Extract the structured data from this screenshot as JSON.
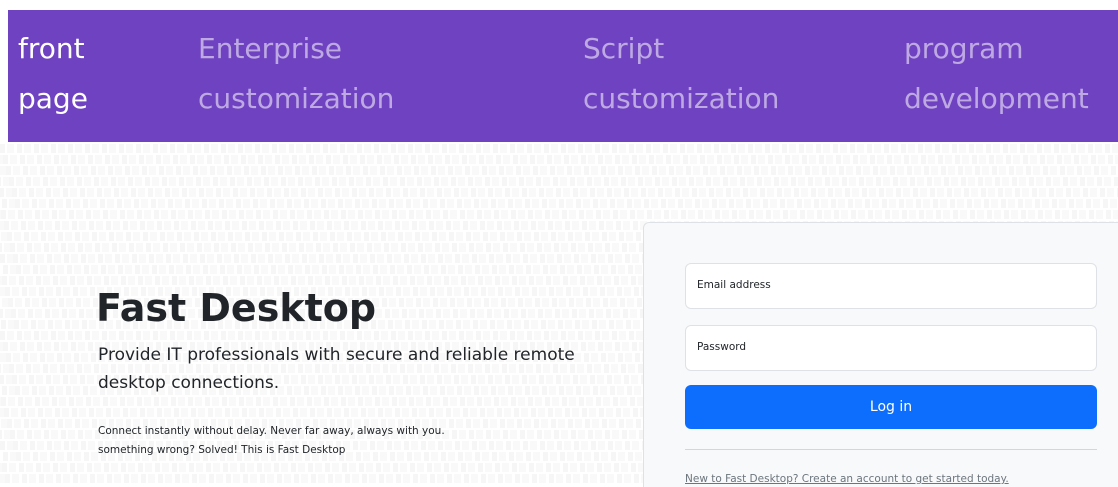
{
  "nav": {
    "items": [
      {
        "line1": "front",
        "line2": "page"
      },
      {
        "line1": "Enterprise",
        "line2": "customization"
      },
      {
        "line1": "Script",
        "line2": "customization"
      },
      {
        "line1": "program",
        "line2": "development"
      }
    ],
    "background_color": "#6f42c1"
  },
  "hero": {
    "title": "Fast Desktop",
    "lead": "Provide IT professionals with secure and reliable remote desktop connections.",
    "small_line1": "Connect instantly without delay. Never far away, always with you.",
    "small_line2": "something wrong? Solved! This is Fast Desktop"
  },
  "login": {
    "email_label": "Email address",
    "password_label": "Password",
    "login_button": "Log in",
    "signup_link": "New to Fast Desktop? Create an account to get started today.",
    "button_color": "#0d6efd"
  }
}
